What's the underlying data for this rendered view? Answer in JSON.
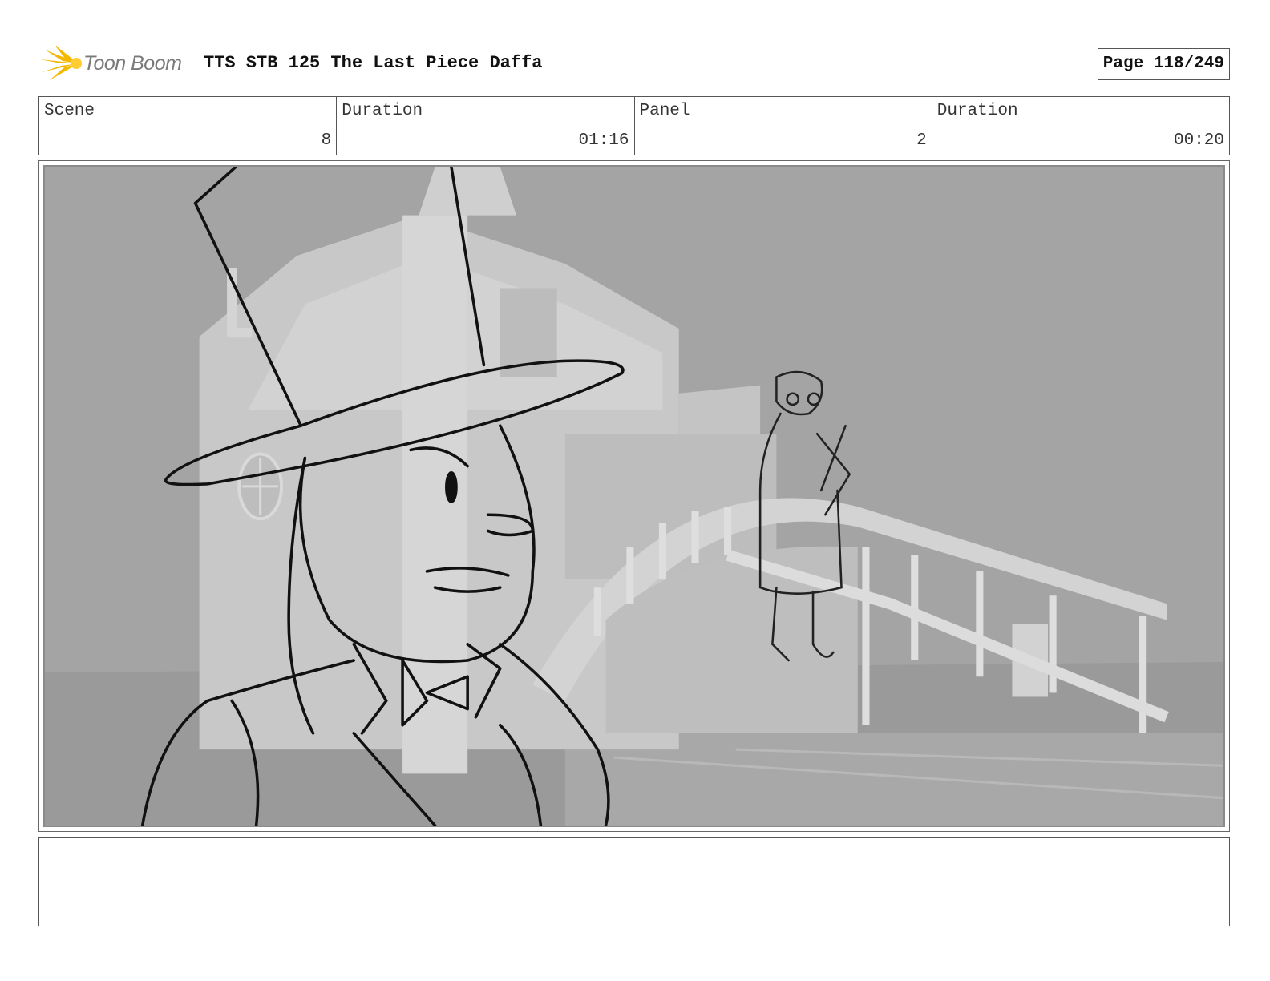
{
  "header": {
    "logo_text": "Toon Boom",
    "title": "TTS STB 125 The Last Piece Daffa",
    "page_label": "Page 118/249"
  },
  "info": [
    {
      "label": "Scene",
      "value": "8"
    },
    {
      "label": "Duration",
      "value": "01:16"
    },
    {
      "label": "Panel",
      "value": "2"
    },
    {
      "label": "Duration",
      "value": "00:20"
    }
  ],
  "panel": {
    "description_icon": "storyboard-sketch-image"
  },
  "notes": {
    "text": ""
  },
  "colors": {
    "logo_accent": "#f5b800",
    "panel_background": "#a6a6a6",
    "border": "#555555"
  }
}
